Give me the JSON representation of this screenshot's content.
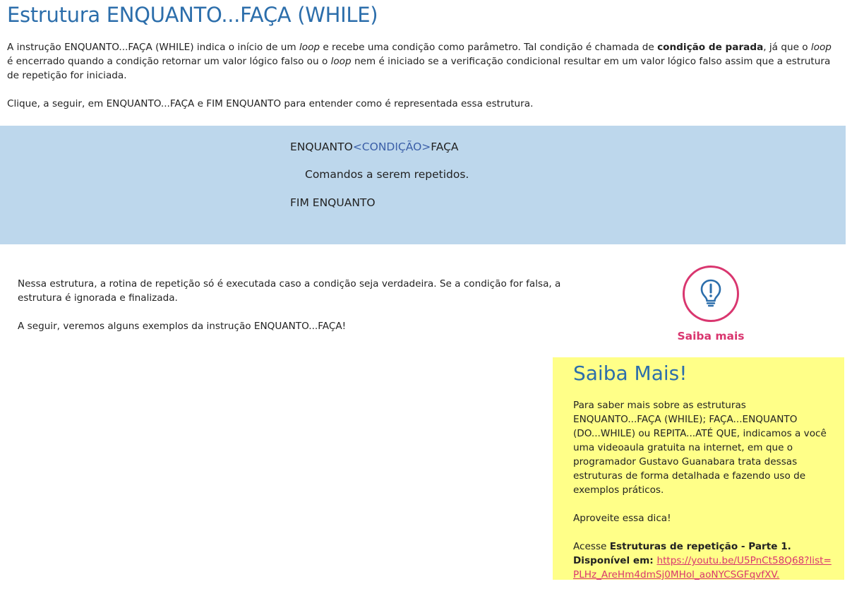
{
  "page": {
    "title": "Estrutura ENQUANTO...FAÇA (WHILE)"
  },
  "intro": {
    "p1_a": "A instrução ENQUANTO...FAÇA (WHILE) indica o início de um ",
    "p1_loop1": "loop",
    "p1_b": " e recebe uma condição como parâmetro. Tal condição é chamada de ",
    "p1_bold": "condição de parada",
    "p1_c": ", já que o ",
    "p1_loop2": "loop",
    "p1_d": " é encerrado quando a condição retornar um valor lógico falso ou o ",
    "p1_loop3": "loop",
    "p1_e": " nem é iniciado se a verificação condicional resultar em um valor lógico falso assim que a estrutura de repetição for iniciada.",
    "p2": "Clique, a seguir, em ENQUANTO...FAÇA e FIM ENQUANTO para entender como é representada essa estrutura."
  },
  "code": {
    "enquanto": "ENQUANTO",
    "condicao": "<CONDIÇÃO>",
    "faca": "FAÇA",
    "comandos": "Comandos a serem repetidos.",
    "fim": "FIM ENQUANTO"
  },
  "body": {
    "p1": "Nessa estrutura, a rotina de repetição só é executada caso a condição seja verdadeira. Se a condição for falsa, a estrutura é ignorada e finalizada.",
    "p2": "A seguir, veremos alguns exemplos da instrução ENQUANTO...FAÇA!"
  },
  "tip": {
    "icon": "lightbulb-icon",
    "label": "Saiba mais",
    "accent": "#d9366f",
    "icon_color": "#2c6eab"
  },
  "saiba": {
    "title": "Saiba Mais!",
    "p1": "Para saber mais sobre as estruturas ENQUANTO...FAÇA (WHILE); FAÇA...ENQUANTO (DO...WHILE) ou REPITA...ATÉ QUE, indicamos a você uma videoaula gratuita na internet, em que o programador Gustavo Guanabara trata dessas estruturas de forma detalhada e fazendo uso de exemplos práticos.",
    "p2": "Aproveite essa dica!",
    "p3_a": "Acesse ",
    "p3_bold": "Estruturas de repetição - Parte 1. Disponível em: ",
    "link_text": "https://youtu.be/U5PnCt58Q68?list=PLHz_AreHm4dmSj0MHol_aoNYCSGFqvfXV.",
    "background": "#ffff88"
  },
  "colors": {
    "heading": "#2c6eab",
    "code_bg": "#bdd7ec",
    "condition": "#3b5fa8"
  }
}
